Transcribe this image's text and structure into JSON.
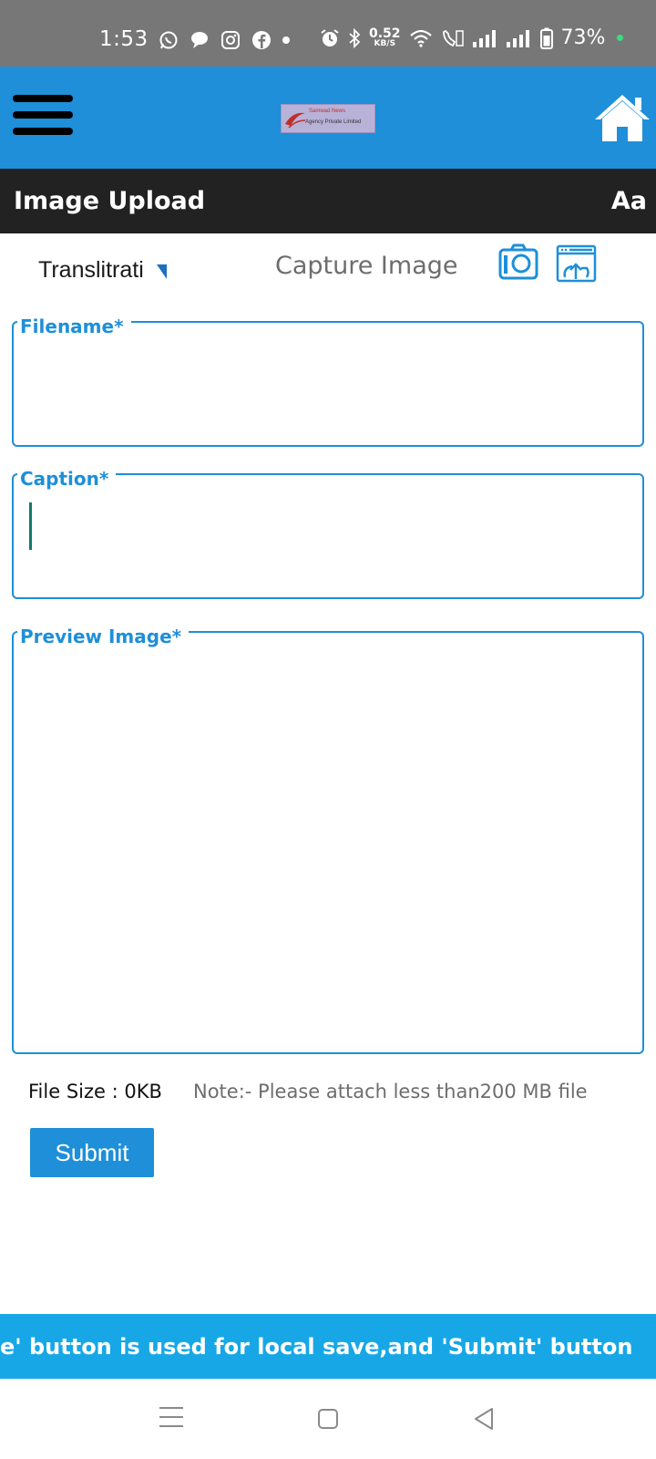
{
  "status_bar": {
    "time": "1:53",
    "net_speed_value": "0.52",
    "net_speed_unit": "KB/S",
    "battery": "73%",
    "left_icons": [
      "whatsapp-icon",
      "chat-bubble-icon",
      "instagram-icon",
      "facebook-icon",
      "dot-icon"
    ],
    "right_icons": [
      "alarm-icon",
      "bluetooth-icon",
      "wifi-icon",
      "volte-call-icon",
      "signal-icon",
      "signal-icon",
      "battery-icon"
    ]
  },
  "app_bar": {
    "logo_line1": "Samwad News",
    "logo_line2": "Agency Private Limited",
    "menu_icon": "hamburger-menu-icon",
    "home_icon": "home-icon",
    "background": "#1e8fd8"
  },
  "title_bar": {
    "title": "Image Upload",
    "font_toggle": "Aa"
  },
  "toolbar": {
    "transliteration_label": "Translitrati",
    "capture_label": "Capture Image",
    "camera_icon": "camera-icon",
    "upload_icon": "upload-from-gallery-icon"
  },
  "form": {
    "filename_label": "Filename*",
    "filename_value": "",
    "caption_label": "Caption*",
    "caption_value": "",
    "preview_label": "Preview Image*"
  },
  "file_info": {
    "size_text": "File Size : 0KB",
    "note_text": "Note:- Please attach less than200 MB file"
  },
  "submit_label": "Submit",
  "marquee_text": "e' button is used for local save,and 'Submit' button",
  "colors": {
    "accent": "#1e8fd8",
    "title_bar": "#222222",
    "marquee": "#17a7e6"
  }
}
